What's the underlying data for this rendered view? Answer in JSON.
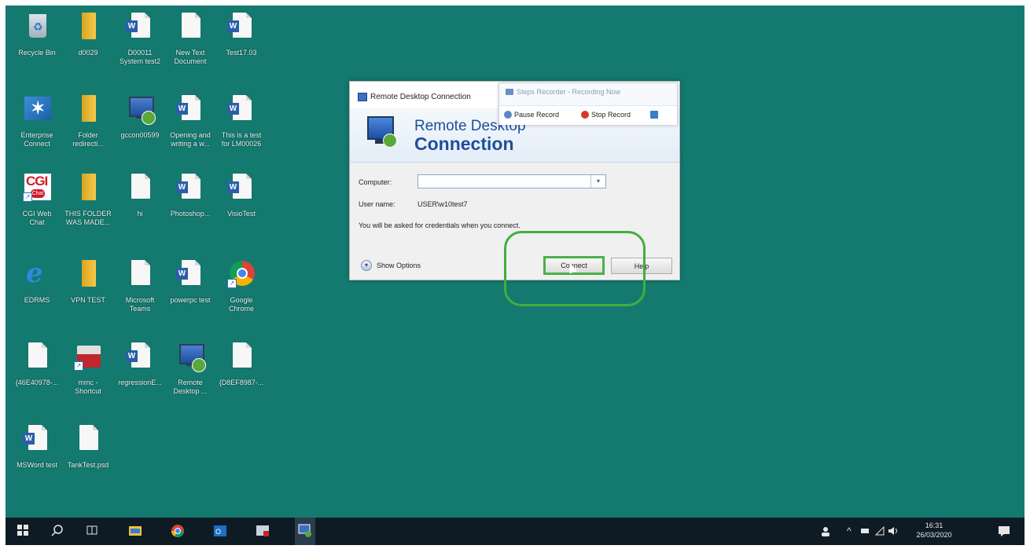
{
  "desktop": {
    "icons": [
      {
        "label": "Recycle Bin",
        "icon": "recycle-bin-icon"
      },
      {
        "label": "d0029",
        "icon": "folder-icon"
      },
      {
        "label": "D00011\nSystem test2",
        "icon": "word-document-icon"
      },
      {
        "label": "New Text\nDocument",
        "icon": "text-document-icon"
      },
      {
        "label": "Test17.03",
        "icon": "word-document-icon"
      },
      {
        "label": "Enterprise\nConnect",
        "icon": "enterprise-connect-icon"
      },
      {
        "label": "Folder\nredirecti...",
        "icon": "folder-icon"
      },
      {
        "label": "gccon00599",
        "icon": "remote-desktop-icon"
      },
      {
        "label": "Opening and\nwriting a w...",
        "icon": "word-document-icon"
      },
      {
        "label": "This is a test\nfor LM00026",
        "icon": "word-document-icon"
      },
      {
        "label": "CGI Web\nChat",
        "icon": "cgi-chat-icon"
      },
      {
        "label": "THIS FOLDER\nWAS MADE...",
        "icon": "folder-icon"
      },
      {
        "label": "hi",
        "icon": "text-document-icon"
      },
      {
        "label": "Photoshop...",
        "icon": "word-document-icon"
      },
      {
        "label": "VisioTest",
        "icon": "word-document-icon"
      },
      {
        "label": "EDRMS",
        "icon": "internet-explorer-icon"
      },
      {
        "label": "VPN TEST",
        "icon": "folder-icon"
      },
      {
        "label": "Microsoft\nTeams",
        "icon": "text-document-icon"
      },
      {
        "label": "powerpc test",
        "icon": "word-document-icon"
      },
      {
        "label": "Google\nChrome",
        "icon": "chrome-icon"
      },
      {
        "label": "{46E40978-...",
        "icon": "text-document-icon"
      },
      {
        "label": "mmc -\nShortcut",
        "icon": "toolbox-icon"
      },
      {
        "label": "regressionE...",
        "icon": "word-document-icon"
      },
      {
        "label": "Remote\nDesktop ...",
        "icon": "remote-desktop-icon"
      },
      {
        "label": "{D8EF8987-...",
        "icon": "text-document-icon"
      },
      {
        "label": "MSWord test",
        "icon": "word-document-icon"
      },
      {
        "label": "TankTest.psd",
        "icon": "text-document-icon"
      }
    ]
  },
  "rdc": {
    "window_title": "Remote Desktop Connection",
    "header_line1": "Remote Desktop",
    "header_line2": "Connection",
    "computer_label": "Computer:",
    "computer_value": "",
    "username_label": "User name:",
    "username_value": "USER\\w10test7",
    "credentials_note": "You will be asked for credentials when you connect.",
    "show_options": "Show Options",
    "connect_label": "Connect",
    "help_label": "Help"
  },
  "steps_recorder": {
    "title": "Steps Recorder - Recording Now",
    "pause_label": "Pause Record",
    "stop_label": "Stop Record"
  },
  "taskbar": {
    "time": "16:31",
    "date": "26/03/2020",
    "items": [
      "start-icon",
      "search-icon",
      "task-view-icon",
      "file-explorer-icon",
      "chrome-icon",
      "outlook-icon",
      "mmc-icon",
      "remote-desktop-icon"
    ]
  },
  "colors": {
    "desktop": "#147a70",
    "highlight": "#44ad3c",
    "taskbar": "#0f1b24"
  }
}
